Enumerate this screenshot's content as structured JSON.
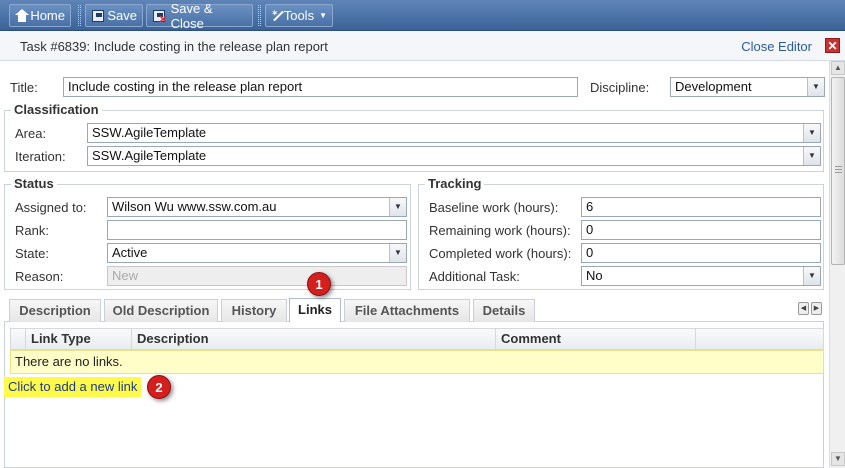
{
  "toolbar": {
    "home_label": "Home",
    "save_label": "Save",
    "save_close_label": "Save & Close",
    "tools_label": "Tools"
  },
  "header": {
    "task_title": "Task #6839: Include costing in the release plan report",
    "close_editor": "Close Editor"
  },
  "form": {
    "title_label": "Title:",
    "title_value": "Include costing in the release plan report",
    "discipline_label": "Discipline:",
    "discipline_value": "Development",
    "classification_legend": "Classification",
    "area_label": "Area:",
    "area_value": "SSW.AgileTemplate",
    "iteration_label": "Iteration:",
    "iteration_value": "SSW.AgileTemplate",
    "status_legend": "Status",
    "assigned_label": "Assigned to:",
    "assigned_value": "Wilson Wu www.ssw.com.au",
    "rank_label": "Rank:",
    "rank_value": "",
    "state_label": "State:",
    "state_value": "Active",
    "reason_label": "Reason:",
    "reason_value": "New",
    "tracking_legend": "Tracking",
    "baseline_label": "Baseline work (hours):",
    "baseline_value": "6",
    "remaining_label": "Remaining work (hours):",
    "remaining_value": "0",
    "completed_label": "Completed work (hours):",
    "completed_value": "0",
    "additional_label": "Additional Task:",
    "additional_value": "No"
  },
  "tabs": [
    "Description",
    "Old Description",
    "History",
    "Links",
    "File Attachments",
    "Details"
  ],
  "active_tab": "Links",
  "links": {
    "columns": [
      "Link Type",
      "Description",
      "Comment"
    ],
    "empty_text": "There are no links.",
    "add_link": "Click to add a new link"
  },
  "badges": [
    "1",
    "2"
  ]
}
